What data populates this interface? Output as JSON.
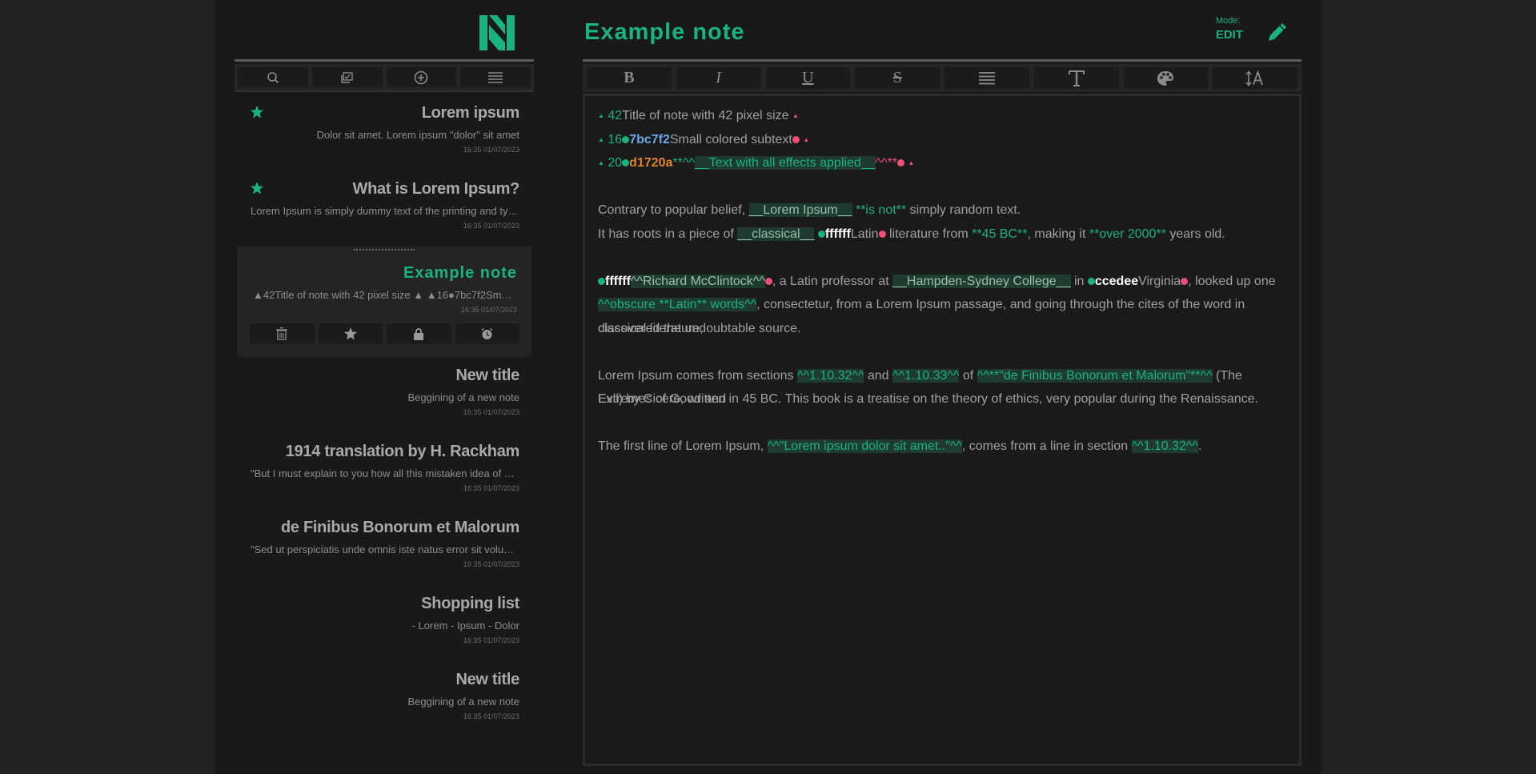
{
  "app": {
    "logo": "n-logo"
  },
  "sidebar": {
    "tools": [
      "search-icon",
      "checklist-icon",
      "add-icon",
      "list-icon"
    ],
    "notes": [
      {
        "title": "Lorem ipsum",
        "preview": "Dolor sit amet. Lorem ipsum \"dolor\" sit amet",
        "date": "16:35 01/07/2023",
        "starred": true
      },
      {
        "title": "What is Lorem Ipsum?",
        "preview": "Lorem Ipsum is simply dummy text of the printing and types...",
        "date": "16:35 01/07/2023",
        "starred": true
      },
      {
        "title": "Example note",
        "preview": "▲42Title of note with 42 pixel size ▲  ▲16●7bc7f2Small col...",
        "date": "16:35 01/07/2023",
        "active": true
      },
      {
        "title": "New title",
        "preview": "Beggining of a new note",
        "date": "16:35 01/07/2023"
      },
      {
        "title": "1914 translation by H. Rackham",
        "preview": "\"But I must explain to you how all this mistaken idea of deno...",
        "date": "16:35 01/07/2023"
      },
      {
        "title": "de Finibus Bonorum et Malorum",
        "preview": "\"Sed ut perspiciatis unde omnis iste natus error sit voluptat...",
        "date": "16:35 01/07/2023"
      },
      {
        "title": "Shopping list",
        "preview": "- Lorem - Ipsum - Dolor",
        "date": "16:35 01/07/2023"
      },
      {
        "title": "New title",
        "preview": "Beggining of a new note",
        "date": "16:35 01/07/2023"
      }
    ],
    "note_actions": [
      "trash-icon",
      "star-icon",
      "lock-icon",
      "clock-icon"
    ]
  },
  "editor": {
    "title": "Example note",
    "mode_label": "Mode:",
    "mode_value": "EDIT",
    "toolbar": [
      "B",
      "I",
      "U",
      "S",
      "align",
      "T",
      "palette",
      "size"
    ],
    "lines": {
      "l1": {
        "size": "42",
        "text": "Title of note with 42 pixel size"
      },
      "l2": {
        "size": "16",
        "color": "7bc7f2",
        "text": "Small colored subtext"
      },
      "l3": {
        "size": "20",
        "color": "d1720a",
        "m1": "**^^",
        "text": "__Text with all effects applied__",
        "m2": "^^**"
      },
      "p1a": "Contrary to popular belief, ",
      "p1b": "__Lorem Ipsum__",
      "p1c": "**is not**",
      "p1d": " simply random text.",
      "p2a": "It has roots in a piece of ",
      "p2b": "__classical__",
      "p2c": "ffffff",
      "p2d": "Latin",
      "p2e": " literature from ",
      "p2f": "**45 BC**",
      "p2g": ", making it ",
      "p2h": "**over 2000**",
      "p2i": " years old.",
      "p3a": "ffffff",
      "p3b": "^^Richard McClintock^^",
      "p3c": ", a Latin professor at ",
      "p3d": "__Hampden-Sydney College__",
      "p3e": " in ",
      "p3f": "ccedee",
      "p3g": "Virginia",
      "p3h": ", looked up one of the more",
      "p4a": "^^obscure **Latin** words^^",
      "p4b": ", consectetur, from a Lorem Ipsum passage, and going through the cites of the word in classical literature,",
      "p5": "discovered the undoubtable source.",
      "p6a": "Lorem Ipsum comes from sections ",
      "p6b": "^^1.10.32^^",
      "p6c": " and ",
      "p6d": "^^1.10.33^^",
      "p6e": " of ",
      "p6f": "^^**\"de Finibus Bonorum et Malorum\"**^^",
      "p6g": " (The Extremes of Good and",
      "p7": "Evil) by Cicero, written in 45 BC. This book is a treatise on the theory of ethics, very popular during the Renaissance.",
      "p8a": "The first line of Lorem Ipsum, ",
      "p8b": "^^\"Lorem ipsum dolor sit amet..\"^^",
      "p8c": ", comes from a line in section ",
      "p8d": "^^1.10.32^^",
      "p8e": "."
    }
  },
  "colors": {
    "accent": "#1ab27d",
    "marker": "#ee4f7a",
    "background": "#191919"
  }
}
